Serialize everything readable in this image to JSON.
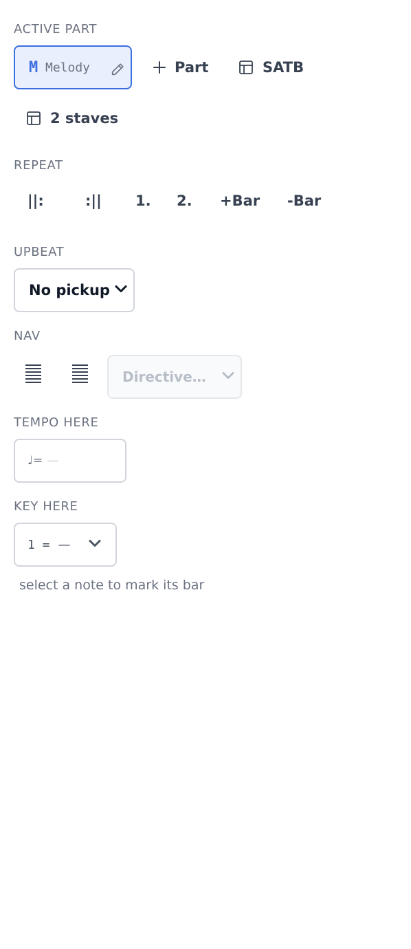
{
  "active_part": {
    "label": "ACTIVE PART",
    "chip_letter": "M",
    "chip_name": "Melody",
    "add_part_label": "Part",
    "satb_label": "SATB",
    "staves_label": "2 staves"
  },
  "repeat": {
    "label": "REPEAT",
    "buttons": [
      "||:",
      ":||",
      "1.",
      "2.",
      "+Bar",
      "-Bar"
    ]
  },
  "upbeat": {
    "label": "UPBEAT",
    "selected": "No pickup"
  },
  "nav": {
    "label": "NAV",
    "directive_placeholder": "Directive…"
  },
  "tempo": {
    "label": "TEMPO HERE",
    "prefix": "♩=",
    "value": "—"
  },
  "key": {
    "label": "KEY HERE",
    "prefix": "1 =",
    "value": "—"
  },
  "hint": "select a note to mark its bar",
  "colors": {
    "accent": "#3b6fe0",
    "chip_bg": "#e9effd",
    "text_muted": "#6b7280",
    "border": "#d1d5db"
  }
}
